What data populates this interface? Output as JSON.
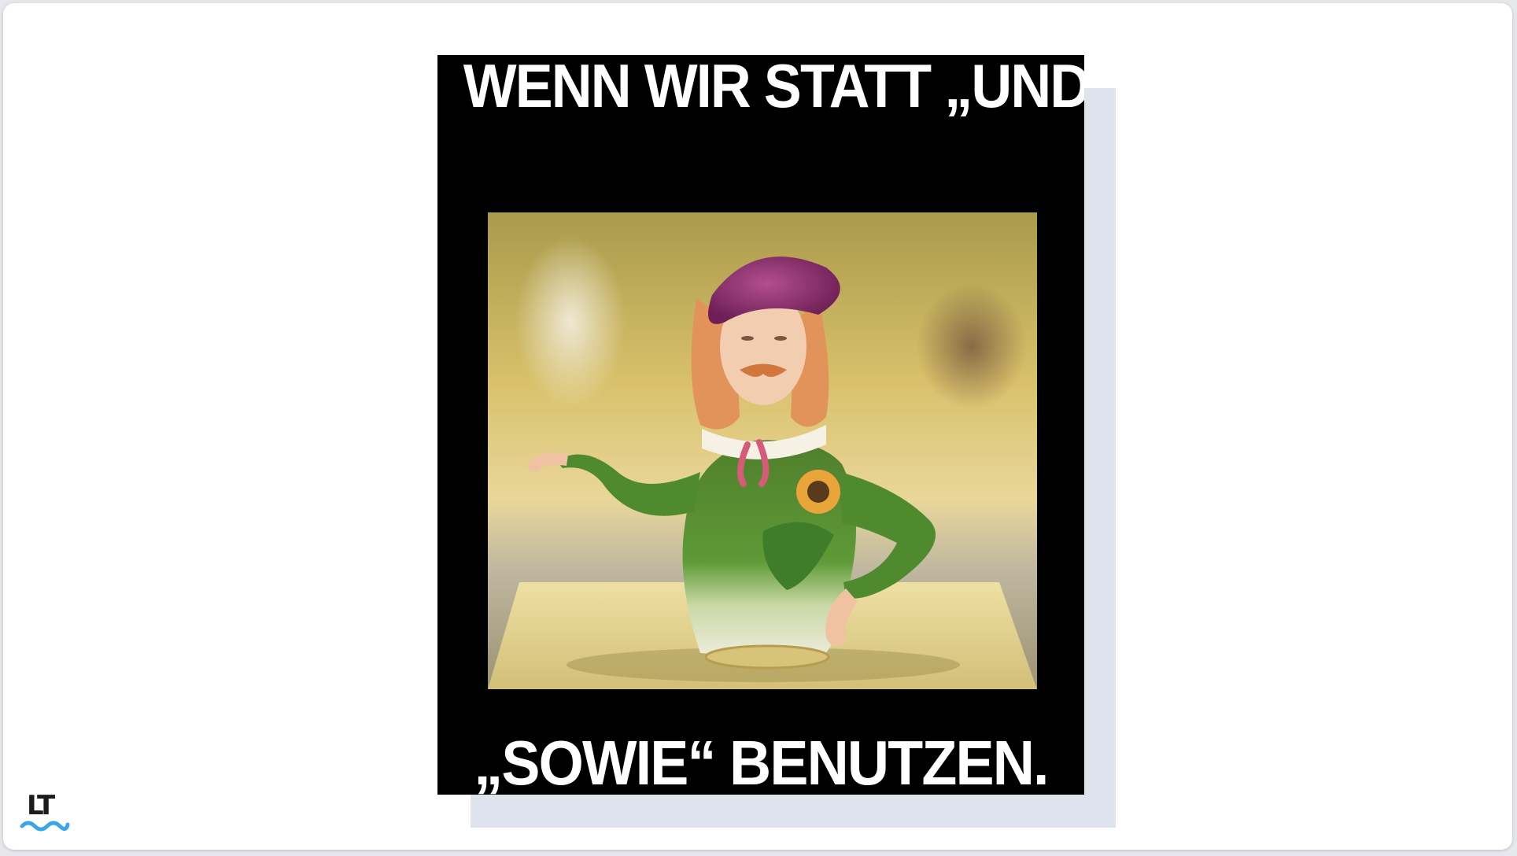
{
  "meme": {
    "top_caption": "WENN WIR STATT „UND“",
    "bottom_caption": "„SOWIE“ BENUTZEN.",
    "photo_subject": "porcelain-teapot-figure"
  },
  "brand": {
    "logo_text": "LT",
    "logo_icon": "languagetool-logo-icon"
  },
  "colors": {
    "page_background": "#ffffff",
    "meme_background": "#000000",
    "shadow_panel": "#dfe3ee",
    "logo_wave": "#3aa6e8",
    "logo_text": "#1c1c1c"
  }
}
